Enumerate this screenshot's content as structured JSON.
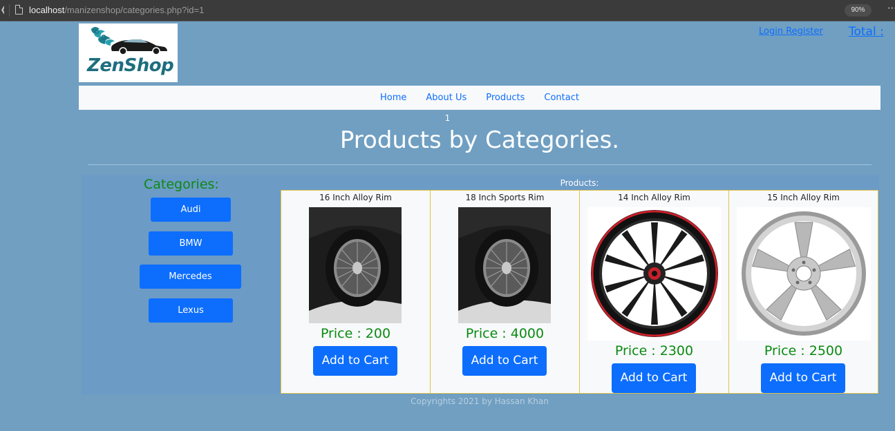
{
  "browser": {
    "url_host": "localhost",
    "url_path": "/manizenshop/categories.php?id=1",
    "zoom": "90%"
  },
  "header": {
    "logo_text": "ZenShop",
    "login_register": "Login Register",
    "total": "Total :"
  },
  "nav": {
    "items": [
      {
        "label": "Home"
      },
      {
        "label": "About Us"
      },
      {
        "label": "Products"
      },
      {
        "label": "Contact"
      }
    ]
  },
  "main": {
    "category_id": "1",
    "title": "Products by Categories.",
    "categories_heading": "Categories:",
    "categories": [
      {
        "label": "Audi"
      },
      {
        "label": "BMW"
      },
      {
        "label": "Mercedes"
      },
      {
        "label": "Lexus"
      }
    ],
    "products_heading": "Products:",
    "products": [
      {
        "name": "16 Inch Alloy Rim",
        "price": "Price : 200",
        "cart_label": "Add to Cart",
        "image": "black-white-mesh-wheel"
      },
      {
        "name": "18 Inch Sports Rim",
        "price": "Price : 4000",
        "cart_label": "Add to Cart",
        "image": "black-white-mesh-wheel"
      },
      {
        "name": "14 Inch Alloy Rim",
        "price": "Price : 2300",
        "cart_label": "Add to Cart",
        "image": "black-red-alloy-rim"
      },
      {
        "name": "15 Inch Alloy Rim",
        "price": "Price : 2500",
        "cart_label": "Add to Cart",
        "image": "silver-alloy-rim"
      }
    ]
  },
  "footer": {
    "text": "Copyrights 2021 by Hassan Khan"
  },
  "colors": {
    "page_bg": "#709fc2",
    "content_bg": "#6c9bc6",
    "primary": "#0d6efd",
    "price_green": "#0a8a12",
    "card_border": "#e0c24a",
    "logo_teal": "#1d6e7e"
  }
}
